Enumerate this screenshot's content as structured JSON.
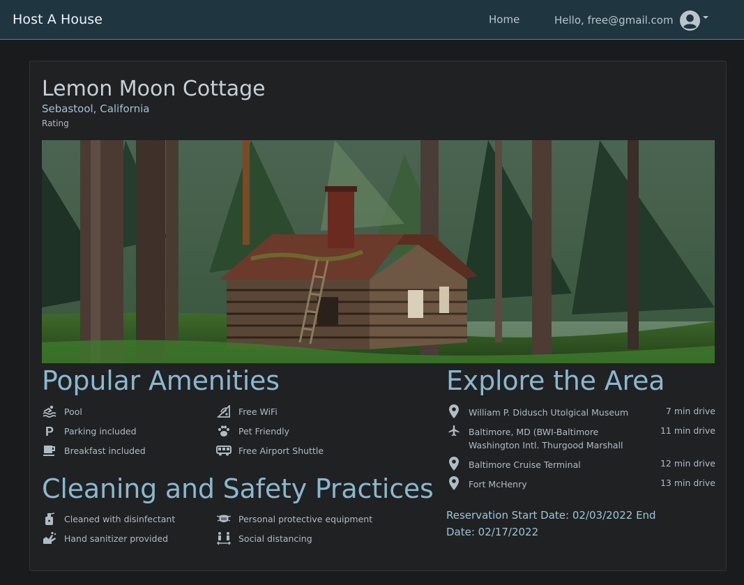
{
  "navbar": {
    "brand": "Host A House",
    "home_label": "Home",
    "user_greeting": "Hello, free@gmail.com"
  },
  "listing": {
    "title": "Lemon Moon Cottage",
    "location": "Sebastool, California",
    "rating_label": "Rating"
  },
  "amenities": {
    "heading": "Popular Amenities",
    "items": [
      {
        "label": "Pool",
        "icon": "swimming-icon"
      },
      {
        "label": "Free WiFi",
        "icon": "wifi-icon"
      },
      {
        "label": "Parking included",
        "icon": "parking-icon"
      },
      {
        "label": "Pet Friendly",
        "icon": "paw-icon"
      },
      {
        "label": "Breakfast included",
        "icon": "coffee-icon"
      },
      {
        "label": "Free Airport Shuttle",
        "icon": "shuttle-icon"
      }
    ]
  },
  "cleaning": {
    "heading": "Cleaning and Safety Practices",
    "items": [
      {
        "label": "Cleaned with disinfectant",
        "icon": "spray-bottle-icon"
      },
      {
        "label": "Personal protective equipment",
        "icon": "mask-icon"
      },
      {
        "label": "Hand sanitizer provided",
        "icon": "hand-wash-icon"
      },
      {
        "label": "Social distancing",
        "icon": "social-distance-icon"
      }
    ]
  },
  "explore": {
    "heading": "Explore the Area",
    "places": [
      {
        "name": "William P. Didusch Utolgical Museum",
        "drive": "7 min drive",
        "icon": "map-pin-icon"
      },
      {
        "name": "Baltimore, MD (BWI-Baltimore Washington Intl. Thurgood Marshall",
        "drive": "11 min drive",
        "icon": "airplane-icon"
      },
      {
        "name": "Baltimore Cruise Terminal",
        "drive": "12 min drive",
        "icon": "map-pin-icon"
      },
      {
        "name": "Fort McHenry",
        "drive": "13 min drive",
        "icon": "map-pin-icon"
      }
    ]
  },
  "reservation": {
    "text": "Reservation Start Date: 02/03/2022 End Date: 02/17/2022"
  },
  "colors": {
    "navbar_bg": "#1f3641",
    "page_bg": "#1a1b1d",
    "card_bg": "#1f2123",
    "accent": "#8ab8cf"
  }
}
